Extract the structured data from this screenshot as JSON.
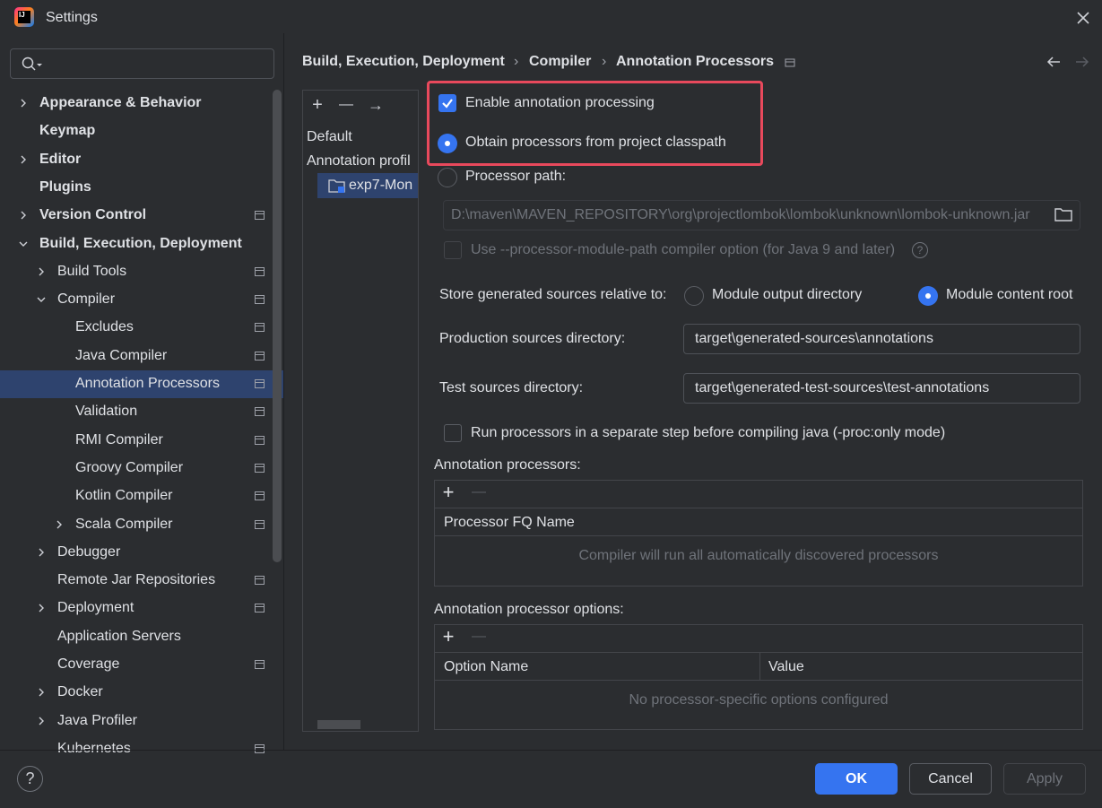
{
  "window": {
    "title": "Settings"
  },
  "search": {
    "placeholder": ""
  },
  "sidebar": {
    "items": [
      {
        "label": "Appearance & Behavior",
        "bold": true,
        "chevron": "right"
      },
      {
        "label": "Keymap",
        "bold": true,
        "chevron": "none"
      },
      {
        "label": "Editor",
        "bold": true,
        "chevron": "right"
      },
      {
        "label": "Plugins",
        "bold": true,
        "chevron": "none"
      },
      {
        "label": "Version Control",
        "bold": true,
        "chevron": "right"
      },
      {
        "label": "Build, Execution, Deployment",
        "bold": true,
        "chevron": "down"
      },
      {
        "label": "Build Tools",
        "chevron": "right"
      },
      {
        "label": "Compiler",
        "chevron": "down"
      },
      {
        "label": "Excludes"
      },
      {
        "label": "Java Compiler"
      },
      {
        "label": "Annotation Processors",
        "selected": true
      },
      {
        "label": "Validation"
      },
      {
        "label": "RMI Compiler"
      },
      {
        "label": "Groovy Compiler"
      },
      {
        "label": "Kotlin Compiler"
      },
      {
        "label": "Scala Compiler",
        "chevron": "right"
      },
      {
        "label": "Debugger",
        "chevron": "right"
      },
      {
        "label": "Remote Jar Repositories"
      },
      {
        "label": "Deployment",
        "chevron": "right"
      },
      {
        "label": "Application Servers"
      },
      {
        "label": "Coverage"
      },
      {
        "label": "Docker",
        "chevron": "right"
      },
      {
        "label": "Java Profiler",
        "chevron": "right"
      },
      {
        "label": "Kubernetes"
      }
    ]
  },
  "breadcrumb": {
    "parts": [
      "Build, Execution, Deployment",
      "Compiler",
      "Annotation Processors"
    ],
    "separator": "›"
  },
  "profiles": {
    "add": "+",
    "remove": "—",
    "move": "→",
    "default_label": "Default",
    "annotation_profile_label": "Annotation profil",
    "module_label": "exp7-Mon"
  },
  "settings": {
    "enable_annotation_processing": {
      "label": "Enable annotation processing",
      "checked": true
    },
    "obtain_from_classpath": {
      "label": "Obtain processors from project classpath",
      "selected": true
    },
    "processor_path": {
      "label": "Processor path:",
      "selected": false,
      "value": "D:\\maven\\MAVEN_REPOSITORY\\org\\projectlombok\\lombok\\unknown\\lombok-unknown.jar"
    },
    "processor_module_path": {
      "label": "Use --processor-module-path compiler option (for Java 9 and later)",
      "checked": false
    },
    "store_generated": {
      "label": "Store generated sources relative to:",
      "option_module_output": "Module output directory",
      "option_content_root": "Module content root",
      "selected": "Module content root"
    },
    "production_sources": {
      "label": "Production sources directory:",
      "value": "target\\generated-sources\\annotations"
    },
    "test_sources": {
      "label": "Test sources directory:",
      "value": "target\\generated-test-sources\\test-annotations"
    },
    "run_separate_step": {
      "label": "Run processors in a separate step before compiling java (-proc:only mode)",
      "checked": false
    }
  },
  "annotation_processors": {
    "title": "Annotation processors:",
    "column": "Processor FQ Name",
    "empty_text": "Compiler will run all automatically discovered processors"
  },
  "processor_options": {
    "title": "Annotation processor options:",
    "columns": [
      "Option Name",
      "Value"
    ],
    "empty_text": "No processor-specific options configured"
  },
  "footer": {
    "help": "?",
    "ok": "OK",
    "cancel": "Cancel",
    "apply": "Apply"
  },
  "colors": {
    "accent": "#3574f0",
    "highlight_box": "#e8495c",
    "selection": "#2e436e"
  }
}
